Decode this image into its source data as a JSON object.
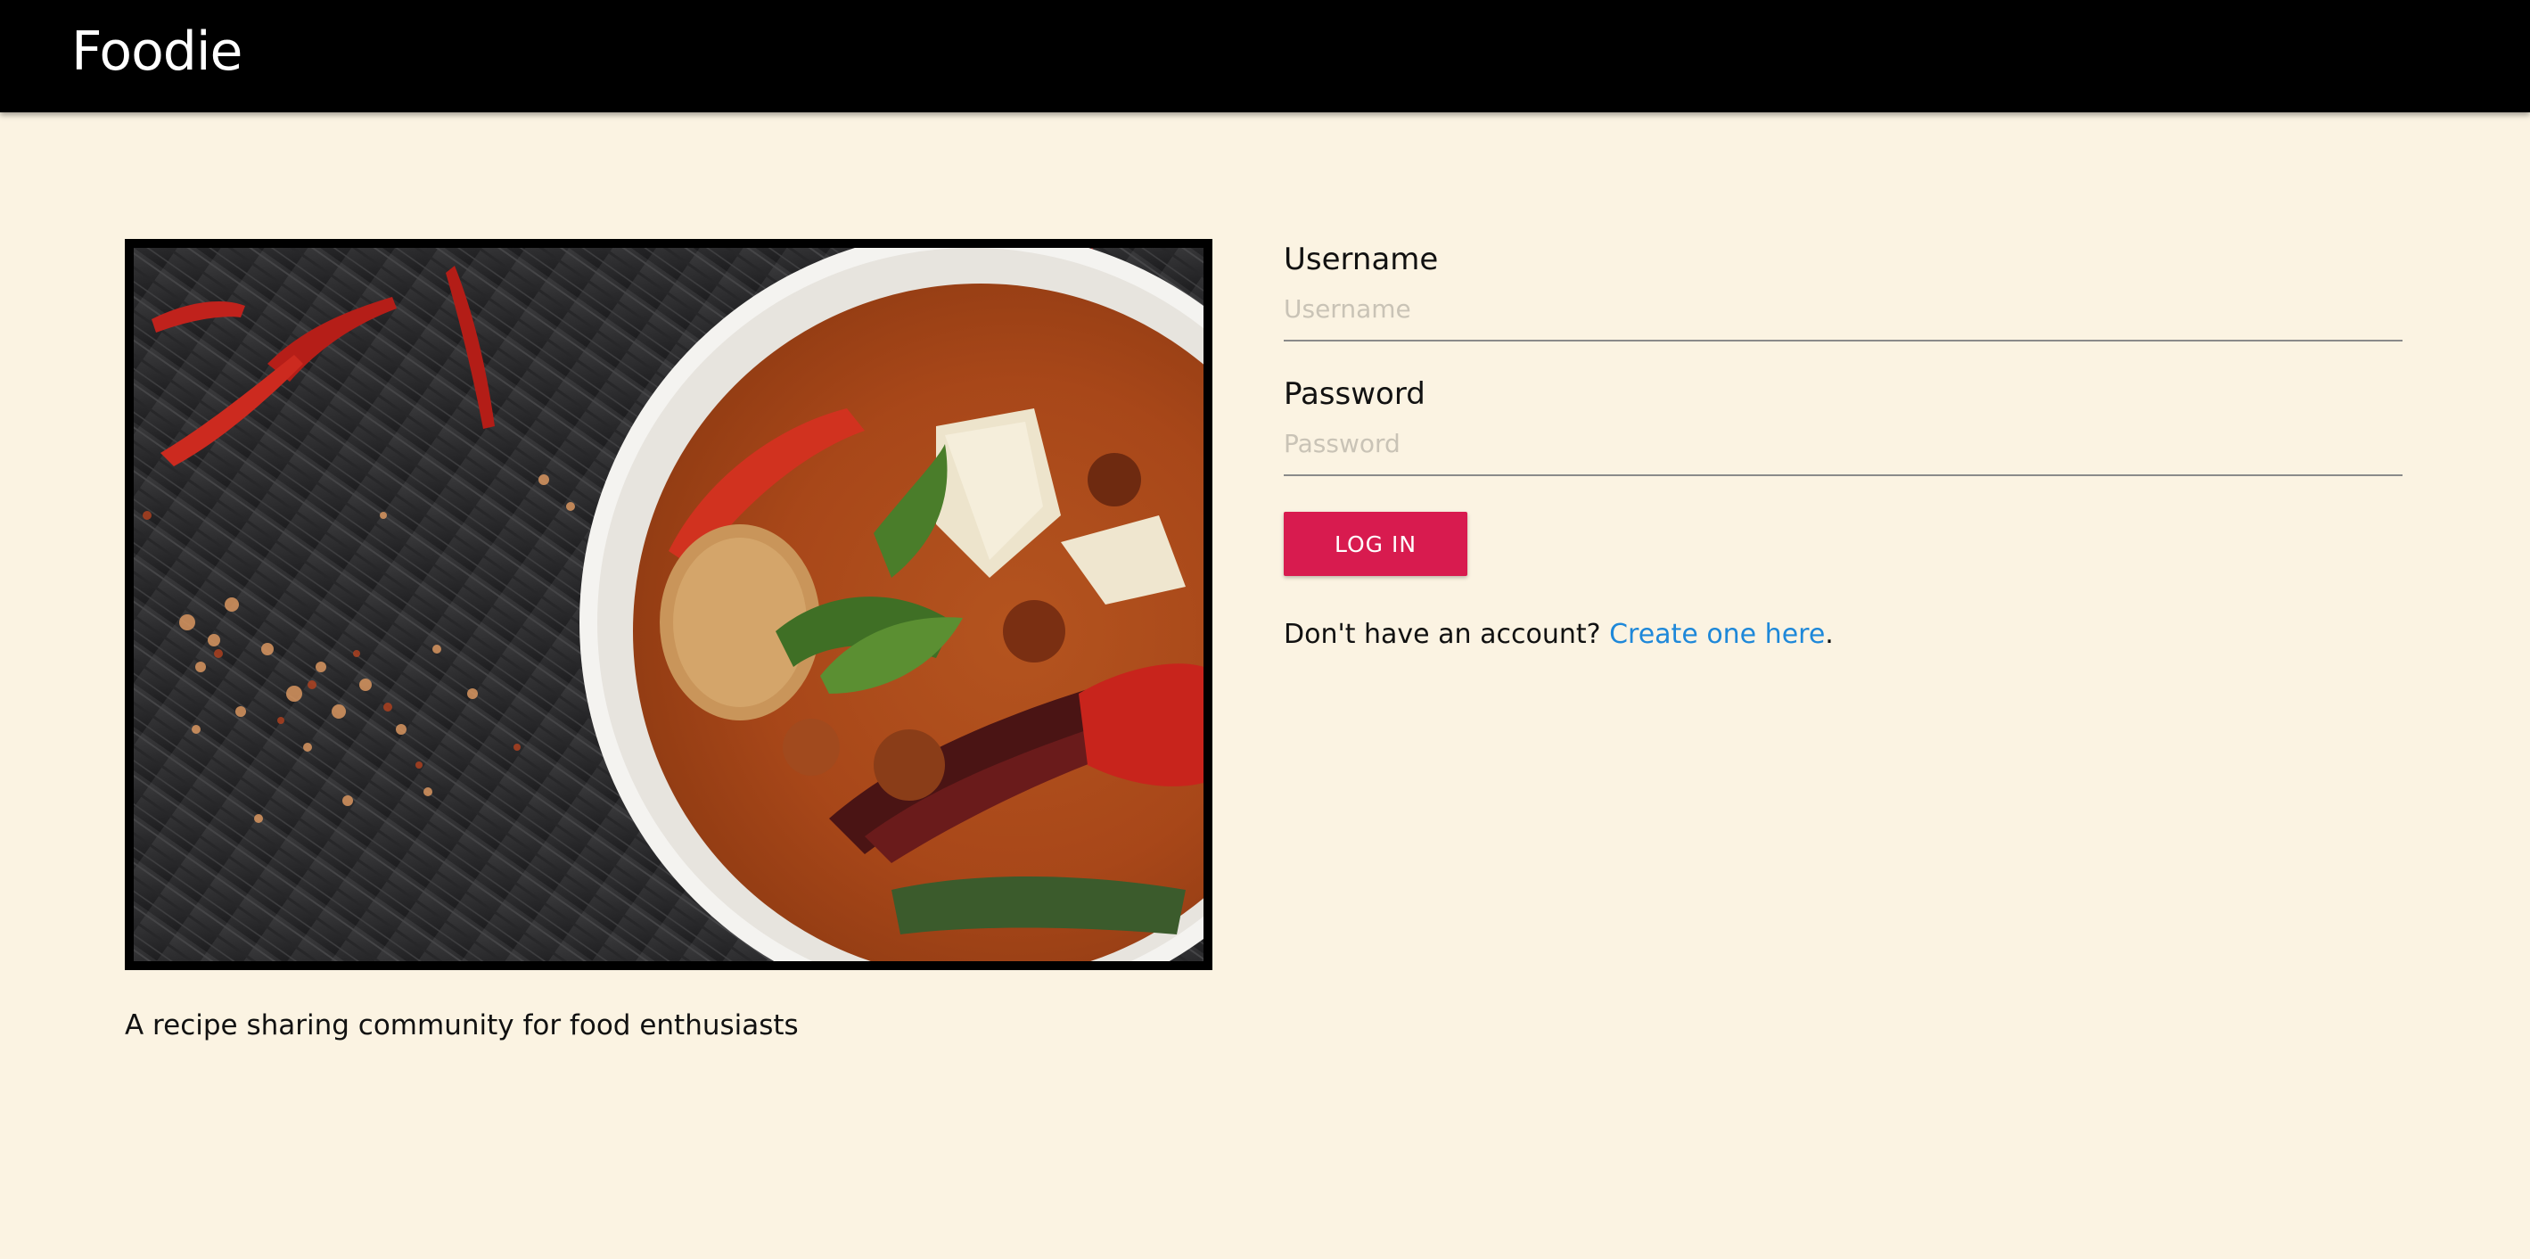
{
  "header": {
    "brand": "Foodie"
  },
  "hero": {
    "image_alt": "Red curry in a white bowl with chilies and basil",
    "tagline": "A recipe sharing community for food enthusiasts"
  },
  "form": {
    "username_label": "Username",
    "username_placeholder": "Username",
    "username_value": "",
    "password_label": "Password",
    "password_placeholder": "Password",
    "password_value": "",
    "login_label": "LOG IN",
    "signup_prefix": "Don't have an account?",
    "signup_link": "Create one here",
    "signup_suffix": "."
  },
  "colors": {
    "page_background": "#fbf3e2",
    "header_background": "#000000",
    "accent_button": "#d81b4f",
    "link": "#1e88d9"
  }
}
